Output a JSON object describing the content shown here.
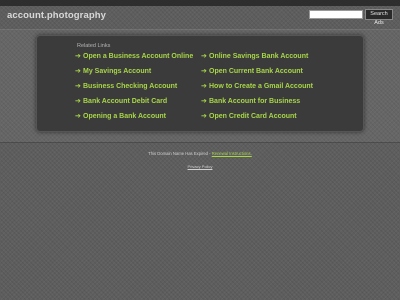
{
  "header": {
    "domain": "account.photography",
    "search_button_label": "Search Ads",
    "search_value": ""
  },
  "related": {
    "heading": "Related Links",
    "arrow_glyph": "➔",
    "link_color": "#a8d648",
    "left_column": [
      "Open a Business Account Online",
      "My Savings Account",
      "Business Checking Account",
      "Bank Account Debit Card",
      "Opening a Bank Account"
    ],
    "right_column": [
      "Online Savings Bank Account",
      "Open Current Bank Account",
      "How to Create a Gmail Account",
      "Bank Account for Business",
      "Open Credit Card Account"
    ]
  },
  "footer": {
    "notice_text": "This Domain Name Has Expired - ",
    "notice_link": "Renewal Instructions.",
    "privacy_label": "Privacy Policy"
  }
}
